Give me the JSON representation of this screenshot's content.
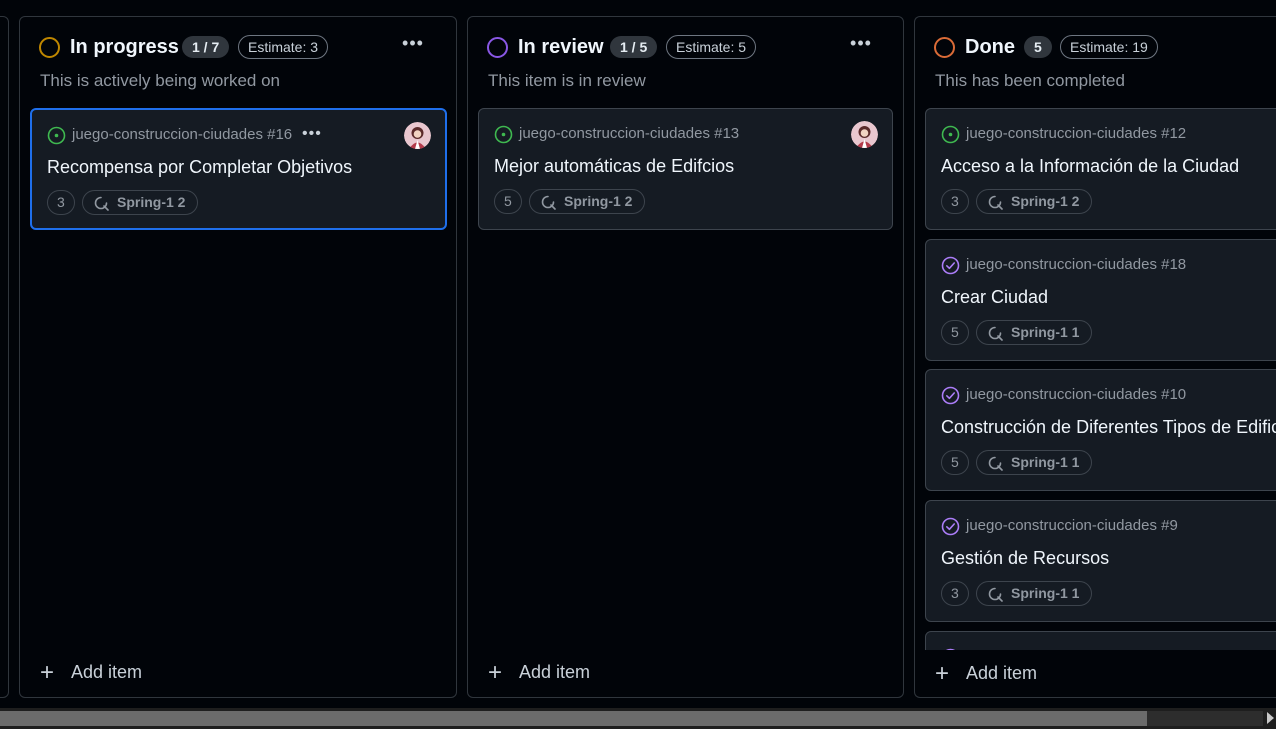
{
  "colors": {
    "in_progress": "#bf8700",
    "in_review": "#8957e5",
    "done": "#da6b37",
    "open_issue": "#3fb950",
    "closed_issue": "#ab7df8",
    "selected_border": "#1f6feb"
  },
  "columns": [
    {
      "title": "In progress",
      "count": "1 / 7",
      "estimate": "Estimate: 3",
      "description": "This is actively being worked on",
      "add_label": "Add item",
      "cards": [
        {
          "repo_ref": "juego-construccion-ciudades #16",
          "title": "Recompensa por Completar Objetivos",
          "estimate": "3",
          "iteration": "Spring-1 2",
          "icon": "issue-open-icon",
          "selected": true,
          "has_avatar": true,
          "has_menu": true
        }
      ]
    },
    {
      "title": "In review",
      "count": "1 / 5",
      "estimate": "Estimate: 5",
      "description": "This item is in review",
      "add_label": "Add item",
      "cards": [
        {
          "repo_ref": "juego-construccion-ciudades #13",
          "title": "Mejor automáticas de Edifcios",
          "estimate": "5",
          "iteration": "Spring-1 2",
          "icon": "issue-open-icon",
          "has_avatar": true
        }
      ]
    },
    {
      "title": "Done",
      "count": "5",
      "estimate": "Estimate: 19",
      "description": "This has been completed",
      "add_label": "Add item",
      "cards": [
        {
          "repo_ref": "juego-construccion-ciudades #12",
          "title": "Acceso a la Información de la Ciudad",
          "estimate": "3",
          "iteration": "Spring-1 2",
          "icon": "issue-open-icon"
        },
        {
          "repo_ref": "juego-construccion-ciudades #18",
          "title": "Crear Ciudad",
          "estimate": "5",
          "iteration": "Spring-1 1",
          "icon": "issue-closed-icon"
        },
        {
          "repo_ref": "juego-construccion-ciudades #10",
          "title": "Construcción de Diferentes Tipos de Edificios",
          "estimate": "5",
          "iteration": "Spring-1 1",
          "icon": "issue-closed-icon"
        },
        {
          "repo_ref": "juego-construccion-ciudades #9",
          "title": "Gestión de Recursos",
          "estimate": "3",
          "iteration": "Spring-1 1",
          "icon": "issue-closed-icon"
        }
      ]
    }
  ]
}
